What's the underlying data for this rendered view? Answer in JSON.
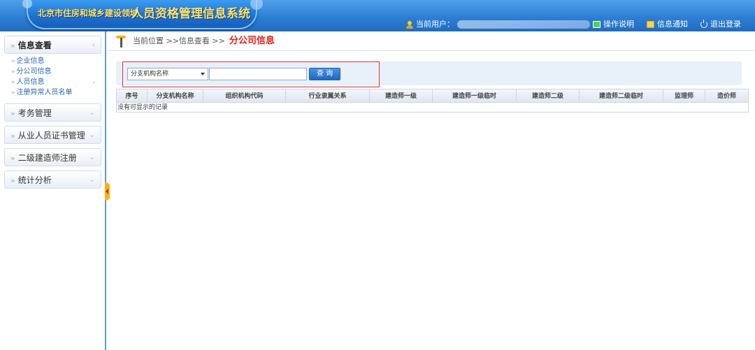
{
  "header": {
    "logo_small": "北京市住房和城乡建设领域",
    "logo_big": "人员资格管理信息系统",
    "current_user_label": "当前用户：",
    "links": [
      {
        "label": "操作说明",
        "icon": "help-icon"
      },
      {
        "label": "信息通知",
        "icon": "mail-icon"
      },
      {
        "label": "退出登录",
        "icon": "power-icon"
      }
    ]
  },
  "sidebar": {
    "sections": [
      {
        "label": "信息查看",
        "active": true,
        "items": [
          {
            "label": "企业信息"
          },
          {
            "label": "分公司信息"
          },
          {
            "label": "人员信息",
            "has_children": true
          },
          {
            "label": "注册异常人员名单"
          }
        ]
      },
      {
        "label": "考务管理"
      },
      {
        "label": "从业人员证书管理"
      },
      {
        "label": "二级建造师注册"
      },
      {
        "label": "统计分析"
      }
    ]
  },
  "breadcrumb": {
    "prefix": "当前位置 >>信息查看 >>",
    "current": "分公司信息"
  },
  "search": {
    "select_value": "分支机构名称",
    "input_value": "",
    "button_label": "查 询"
  },
  "grid": {
    "columns": [
      "序号",
      "分支机构名称",
      "组织机构代码",
      "行业隶属关系",
      "建造师一级",
      "建造师一级临时",
      "建造师二级",
      "建造师二级临时",
      "监理师",
      "造价师"
    ],
    "empty_text": "没有可显示的记录"
  }
}
